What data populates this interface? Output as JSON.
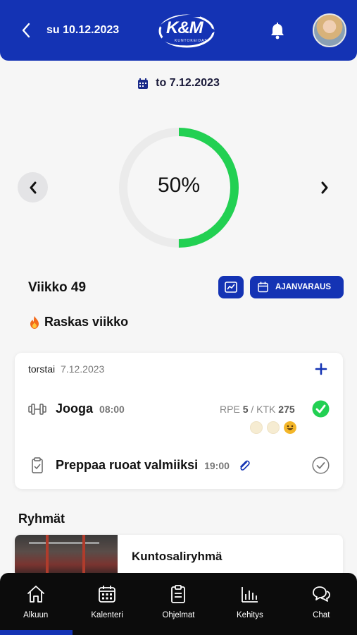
{
  "header": {
    "date_label": "su 10.12.2023",
    "logo_text": "K&M",
    "logo_subtext": "KUNTOKEIDAS"
  },
  "selected_date": "to 7.12.2023",
  "progress": {
    "percent_label": "50%",
    "value": 0.5,
    "color": "#22d052"
  },
  "week": {
    "title": "Viikko 49",
    "tag": "Raskas viikko",
    "booking_label": "AJANVARAUS"
  },
  "day_card": {
    "weekday": "torstai",
    "date": "7.12.2023",
    "events": [
      {
        "title": "Jooga",
        "time": "08:00",
        "rpe_label": "RPE",
        "rpe_value": "5",
        "ktk_label": "KTK",
        "ktk_value": "275",
        "done": true,
        "icon": "dumbbell-icon"
      },
      {
        "title": "Preppaa ruoat valmiiksi",
        "time": "19:00",
        "done": false,
        "icon": "clipboard-check-icon"
      }
    ]
  },
  "groups": {
    "title": "Ryhmät",
    "items": [
      {
        "name": "Kuntosaliryhmä"
      }
    ]
  },
  "nav": {
    "items": [
      {
        "label": "Alkuun",
        "icon": "home-icon"
      },
      {
        "label": "Kalenteri",
        "icon": "calendar-icon"
      },
      {
        "label": "Ohjelmat",
        "icon": "clipboard-icon"
      },
      {
        "label": "Kehitys",
        "icon": "bar-chart-icon"
      },
      {
        "label": "Chat",
        "icon": "chat-icon"
      }
    ],
    "active_index": 0
  },
  "colors": {
    "brand": "#1433b4",
    "success": "#22d052",
    "nav_bg": "#0c0c0c"
  }
}
